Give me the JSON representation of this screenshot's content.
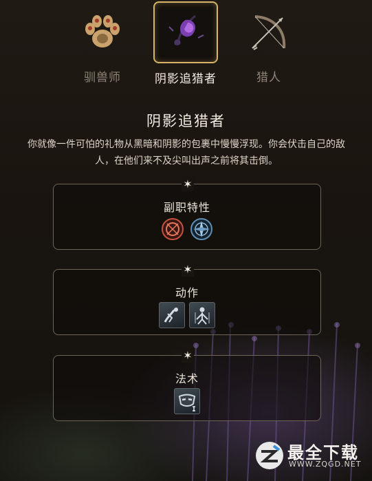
{
  "subclasses": [
    {
      "label": "驯兽师",
      "icon": "paw-icon",
      "selected": false
    },
    {
      "label": "阴影追猎者",
      "icon": "shadow-flower-icon",
      "selected": true
    },
    {
      "label": "猎人",
      "icon": "bow-icon",
      "selected": false
    }
  ],
  "detail": {
    "title": "阴影追猎者",
    "description": "你就像一件可怕的礼物从黑暗和阴影的包裹中慢慢浮现。你会伏击自己的敌人，在他们来不及尖叫出声之前将其击倒。"
  },
  "panels": [
    {
      "title": "副职特性",
      "icons": [
        "red-sigil-icon",
        "blue-compass-icon"
      ]
    },
    {
      "title": "动作",
      "icons": [
        "lunge-action-icon",
        "umbral-figure-action-icon"
      ]
    },
    {
      "title": "法术",
      "icons": [
        "disguise-mask-spell-icon"
      ]
    }
  ],
  "watermark": {
    "main": "最全下载",
    "sub": "WWW.ZQGD.NET"
  },
  "colors": {
    "accent_gold": "#d8b46a",
    "selected_text": "#f2ece2",
    "muted_text": "#8f8578"
  }
}
